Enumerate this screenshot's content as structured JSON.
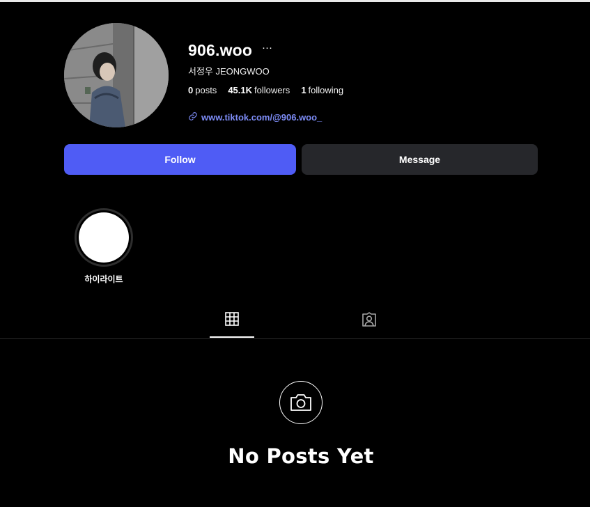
{
  "profile": {
    "username": "906.woo",
    "more_label": "···",
    "full_name": "서정우 JEONGWOO",
    "stats": {
      "posts_count": "0",
      "posts_label": "posts",
      "followers_count": "45.1K",
      "followers_label": "followers",
      "following_count": "1",
      "following_label": "following"
    },
    "link_text": "www.tiktok.com/@906.woo_"
  },
  "actions": {
    "follow_label": "Follow",
    "message_label": "Message"
  },
  "highlights": [
    {
      "label": "하이라이트"
    }
  ],
  "tabs": [
    {
      "name": "posts",
      "icon": "grid-icon",
      "active": true
    },
    {
      "name": "tagged",
      "icon": "tagged-user-icon",
      "active": false
    }
  ],
  "empty_state": {
    "icon": "camera-icon",
    "title": "No Posts Yet"
  },
  "colors": {
    "background": "#000000",
    "accent": "#4f5cf5",
    "link": "#7d8cf6",
    "secondary_button": "#26272b"
  }
}
